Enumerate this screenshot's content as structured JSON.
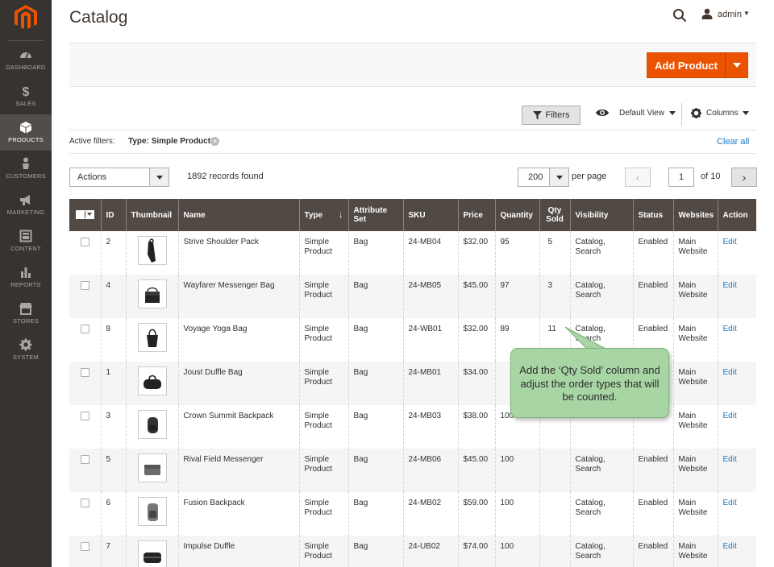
{
  "app": {
    "page_title": "Catalog",
    "user": "admin"
  },
  "sidebar": {
    "items": [
      {
        "label": "DASHBOARD",
        "icon": "dashboard-icon",
        "active": false
      },
      {
        "label": "SALES",
        "icon": "dollar-icon",
        "active": false
      },
      {
        "label": "PRODUCTS",
        "icon": "cube-icon",
        "active": true
      },
      {
        "label": "CUSTOMERS",
        "icon": "person-icon",
        "active": false
      },
      {
        "label": "MARKETING",
        "icon": "megaphone-icon",
        "active": false
      },
      {
        "label": "CONTENT",
        "icon": "layout-icon",
        "active": false
      },
      {
        "label": "REPORTS",
        "icon": "bar-chart-icon",
        "active": false
      },
      {
        "label": "STORES",
        "icon": "store-icon",
        "active": false
      },
      {
        "label": "SYSTEM",
        "icon": "gear-icon",
        "active": false
      }
    ]
  },
  "page_actions": {
    "add_product": "Add Product"
  },
  "grid_controls": {
    "filters": "Filters",
    "default_view": "Default View",
    "columns": "Columns",
    "active_filters_label": "Active filters:",
    "active_filter_value": "Type: Simple Product",
    "clear_all": "Clear all",
    "actions": "Actions",
    "records_found": "1892 records found",
    "per_page_value": "200",
    "per_page_label": "per page",
    "current_page": "1",
    "of_pages": "of 10"
  },
  "table": {
    "columns": [
      "ID",
      "Thumbnail",
      "Name",
      "Type",
      "Attribute Set",
      "SKU",
      "Price",
      "Quantity",
      "Qty Sold",
      "Visibility",
      "Status",
      "Websites",
      "Action"
    ],
    "rows": [
      {
        "id": "2",
        "name": "Strive Shoulder Pack",
        "type": "Simple Product",
        "attr": "Bag",
        "sku": "24-MB04",
        "price": "$32.00",
        "qty": "95",
        "sold": "5",
        "visibility": "Catalog, Search",
        "status": "Enabled",
        "websites": "Main Website",
        "action": "Edit",
        "thumb": "shoulder-pack"
      },
      {
        "id": "4",
        "name": "Wayfarer Messenger Bag",
        "type": "Simple Product",
        "attr": "Bag",
        "sku": "24-MB05",
        "price": "$45.00",
        "qty": "97",
        "sold": "3",
        "visibility": "Catalog, Search",
        "status": "Enabled",
        "websites": "Main Website",
        "action": "Edit",
        "thumb": "messenger"
      },
      {
        "id": "8",
        "name": "Voyage Yoga Bag",
        "type": "Simple Product",
        "attr": "Bag",
        "sku": "24-WB01",
        "price": "$32.00",
        "qty": "89",
        "sold": "11",
        "visibility": "Catalog, Search",
        "status": "Enabled",
        "websites": "Main Website",
        "action": "Edit",
        "thumb": "tote"
      },
      {
        "id": "1",
        "name": "Joust Duffle Bag",
        "type": "Simple Product",
        "attr": "Bag",
        "sku": "24-MB01",
        "price": "$34.00",
        "qty": "",
        "sold": "",
        "visibility": "",
        "status": "",
        "websites": "Main Website",
        "action": "Edit",
        "thumb": "duffle"
      },
      {
        "id": "3",
        "name": "Crown Summit Backpack",
        "type": "Simple Product",
        "attr": "Bag",
        "sku": "24-MB03",
        "price": "$38.00",
        "qty": "100",
        "sold": "",
        "visibility": "Search",
        "status": "",
        "websites": "Main Website",
        "action": "Edit",
        "thumb": "backpack"
      },
      {
        "id": "5",
        "name": "Rival Field Messenger",
        "type": "Simple Product",
        "attr": "Bag",
        "sku": "24-MB06",
        "price": "$45.00",
        "qty": "100",
        "sold": "",
        "visibility": "Catalog, Search",
        "status": "Enabled",
        "websites": "Main Website",
        "action": "Edit",
        "thumb": "field-messenger"
      },
      {
        "id": "6",
        "name": "Fusion Backpack",
        "type": "Simple Product",
        "attr": "Bag",
        "sku": "24-MB02",
        "price": "$59.00",
        "qty": "100",
        "sold": "",
        "visibility": "Catalog, Search",
        "status": "Enabled",
        "websites": "Main Website",
        "action": "Edit",
        "thumb": "fusion-backpack"
      },
      {
        "id": "7",
        "name": "Impulse Duffle",
        "type": "Simple Product",
        "attr": "Bag",
        "sku": "24-UB02",
        "price": "$74.00",
        "qty": "100",
        "sold": "",
        "visibility": "Catalog, Search",
        "status": "Enabled",
        "websites": "Main Website",
        "action": "Edit",
        "thumb": "impulse-duffle"
      }
    ]
  },
  "callout": {
    "text": "Add the ‘Qty Sold’ column and adjust the order types that will be counted."
  },
  "colors": {
    "sidebar": "#373330",
    "accent": "#eb5202",
    "table_header": "#514943",
    "link": "#1979c3",
    "callout": "#a8d5a4"
  }
}
